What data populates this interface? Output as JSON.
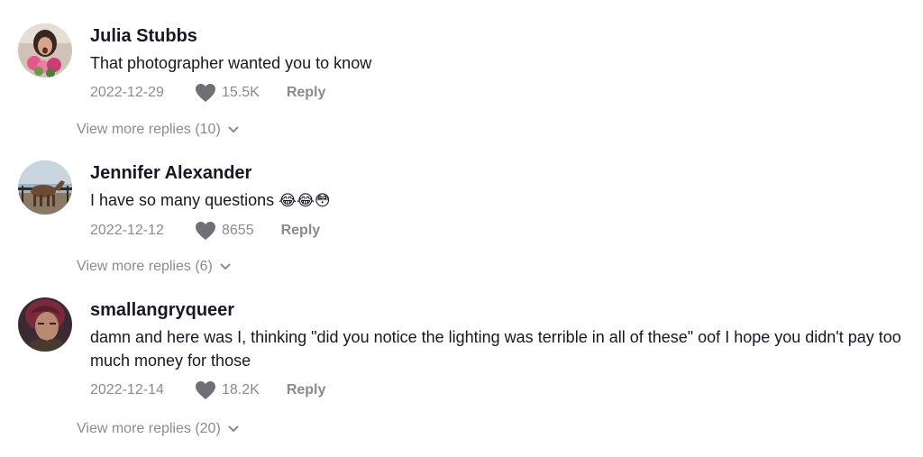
{
  "comments": [
    {
      "username": "Julia Stubbs",
      "text": "That photographer wanted you to know",
      "date": "2022-12-29",
      "likes": "15.5K",
      "reply_label": "Reply",
      "view_more": "View more replies (10)"
    },
    {
      "username": "Jennifer Alexander",
      "text": "I have so many questions",
      "emoji": "😂😂😳",
      "date": "2022-12-12",
      "likes": "8655",
      "reply_label": "Reply",
      "view_more": "View more replies (6)"
    },
    {
      "username": "smallangryqueer",
      "text": "damn and here was I, thinking \"did you notice the lighting was terrible in all of these\" oof I hope you didn't pay too much money for those",
      "date": "2022-12-14",
      "likes": "18.2K",
      "reply_label": "Reply",
      "view_more": "View more replies (20)"
    }
  ],
  "colors": {
    "text_primary": "#161823",
    "text_secondary": "#8a8b91",
    "heart": "#6f7077"
  },
  "icons": {
    "like": "heart-icon",
    "expand": "chevron-down-icon"
  }
}
